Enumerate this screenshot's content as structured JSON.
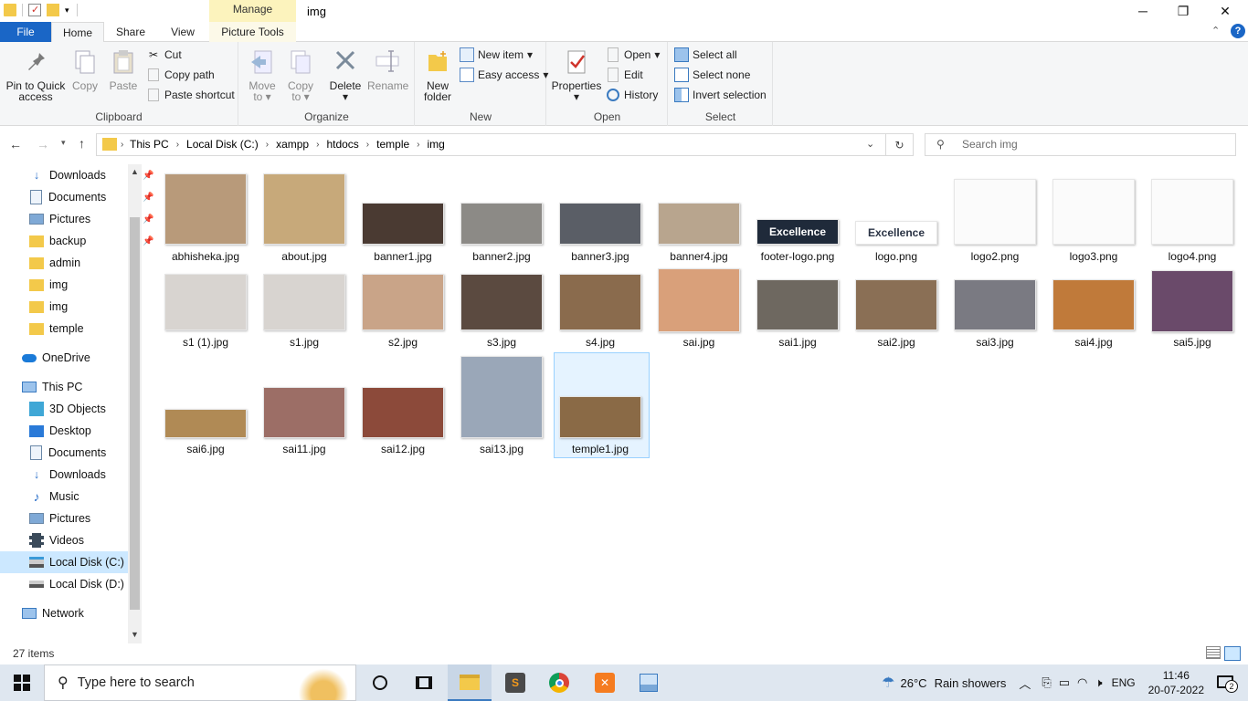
{
  "window": {
    "title": "img",
    "manage_label": "Manage",
    "minimize_glyph": "─",
    "restore_glyph": "❐",
    "close_glyph": "✕"
  },
  "ribbon_tabs": {
    "file": "File",
    "home": "Home",
    "share": "Share",
    "view": "View",
    "picture_tools": "Picture Tools"
  },
  "ribbon": {
    "clipboard": {
      "label": "Clipboard",
      "pin": "Pin to Quick access",
      "pin_line1": "Pin to Quick",
      "pin_line2": "access",
      "copy": "Copy",
      "paste": "Paste",
      "cut": "Cut",
      "copy_path": "Copy path",
      "paste_shortcut": "Paste shortcut"
    },
    "organize": {
      "label": "Organize",
      "move_to_1": "Move",
      "move_to_2": "to",
      "copy_to_1": "Copy",
      "copy_to_2": "to",
      "delete": "Delete",
      "rename": "Rename"
    },
    "new": {
      "label": "New",
      "new_folder_1": "New",
      "new_folder_2": "folder",
      "new_item": "New item",
      "easy_access": "Easy access"
    },
    "open": {
      "label": "Open",
      "properties": "Properties",
      "open": "Open",
      "edit": "Edit",
      "history": "History"
    },
    "select": {
      "label": "Select",
      "select_all": "Select all",
      "select_none": "Select none",
      "invert": "Invert selection"
    }
  },
  "address": {
    "crumbs": [
      "This PC",
      "Local Disk (C:)",
      "xampp",
      "htdocs",
      "temple",
      "img"
    ],
    "search_placeholder": "Search img"
  },
  "nav": {
    "quick": [
      "Downloads",
      "Documents",
      "Pictures",
      "backup",
      "admin",
      "img",
      "img",
      "temple"
    ],
    "onedrive": "OneDrive",
    "thispc": "This PC",
    "pc_items": [
      "3D Objects",
      "Desktop",
      "Documents",
      "Downloads",
      "Music",
      "Pictures",
      "Videos",
      "Local Disk (C:)",
      "Local Disk (D:)"
    ],
    "network": "Network"
  },
  "files": [
    {
      "name": "abhisheka.jpg",
      "color": "#b89a7a"
    },
    {
      "name": "about.jpg",
      "color": "#c7a97a"
    },
    {
      "name": "banner1.jpg",
      "color": "#4a3a32"
    },
    {
      "name": "banner2.jpg",
      "color": "#8c8a86"
    },
    {
      "name": "banner3.jpg",
      "color": "#5a5e66"
    },
    {
      "name": "banner4.jpg",
      "color": "#b8a58e"
    },
    {
      "name": "footer-logo.png",
      "color": "#1f2a3a",
      "logo_text": "Excellence"
    },
    {
      "name": "logo.png",
      "color": "#ffffff",
      "logo_text": "Excellence"
    },
    {
      "name": "logo2.png",
      "color": "#fbfbfb"
    },
    {
      "name": "logo3.png",
      "color": "#fbfbfb"
    },
    {
      "name": "logo4.png",
      "color": "#fbfbfb"
    },
    {
      "name": "s1 (1).jpg",
      "color": "#d8d4d0"
    },
    {
      "name": "s1.jpg",
      "color": "#d8d4d0"
    },
    {
      "name": "s2.jpg",
      "color": "#c9a488"
    },
    {
      "name": "s3.jpg",
      "color": "#5b4a40"
    },
    {
      "name": "s4.jpg",
      "color": "#8a6b4d"
    },
    {
      "name": "sai.jpg",
      "color": "#d9a07a"
    },
    {
      "name": "sai1.jpg",
      "color": "#6e6860"
    },
    {
      "name": "sai2.jpg",
      "color": "#8a6f55"
    },
    {
      "name": "sai3.jpg",
      "color": "#7a7a82"
    },
    {
      "name": "sai4.jpg",
      "color": "#c07a3a"
    },
    {
      "name": "sai5.jpg",
      "color": "#6a4a6a"
    },
    {
      "name": "sai6.jpg",
      "color": "#b08a55"
    },
    {
      "name": "sai11.jpg",
      "color": "#9c6e66"
    },
    {
      "name": "sai12.jpg",
      "color": "#8c4a3a"
    },
    {
      "name": "sai13.jpg",
      "color": "#9aa7b8"
    },
    {
      "name": "temple1.jpg",
      "color": "#8a6a46"
    }
  ],
  "status": {
    "items": "27 items"
  },
  "taskbar": {
    "search_placeholder": "Type here to search",
    "weather_temp": "26°C",
    "weather_desc": "Rain showers",
    "lang": "ENG",
    "time": "11:46",
    "date": "20-07-2022",
    "notif_count": "2"
  }
}
